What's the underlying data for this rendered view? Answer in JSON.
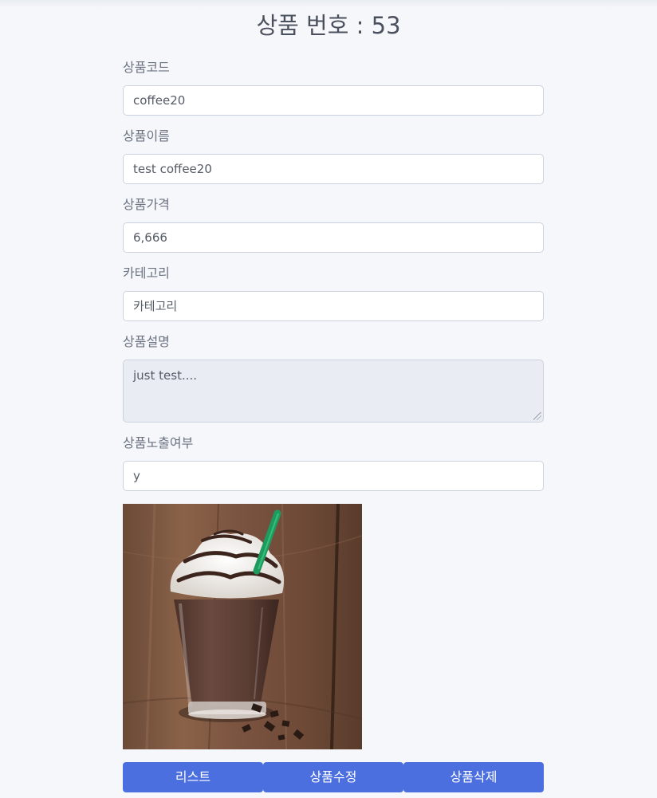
{
  "page": {
    "title": "상품 번호 : 53"
  },
  "form": {
    "code": {
      "label": "상품코드",
      "value": "coffee20"
    },
    "name": {
      "label": "상품이름",
      "value": "test coffee20"
    },
    "price": {
      "label": "상품가격",
      "value": "6,666"
    },
    "category": {
      "label": "카테고리",
      "value": "카테고리"
    },
    "description": {
      "label": "상품설명",
      "value": "just test...."
    },
    "display": {
      "label": "상품노출여부",
      "value": "y"
    }
  },
  "image": {
    "subject": "chocolate frappuccino with whipped cream and green straw"
  },
  "buttons": {
    "list": "리스트",
    "edit": "상품수정",
    "delete": "상품삭제"
  },
  "colors": {
    "background": "#f5f7fb",
    "button": "#4c6fe0",
    "textarea_bg": "#e9ecf3",
    "border": "#ccd2dd"
  }
}
